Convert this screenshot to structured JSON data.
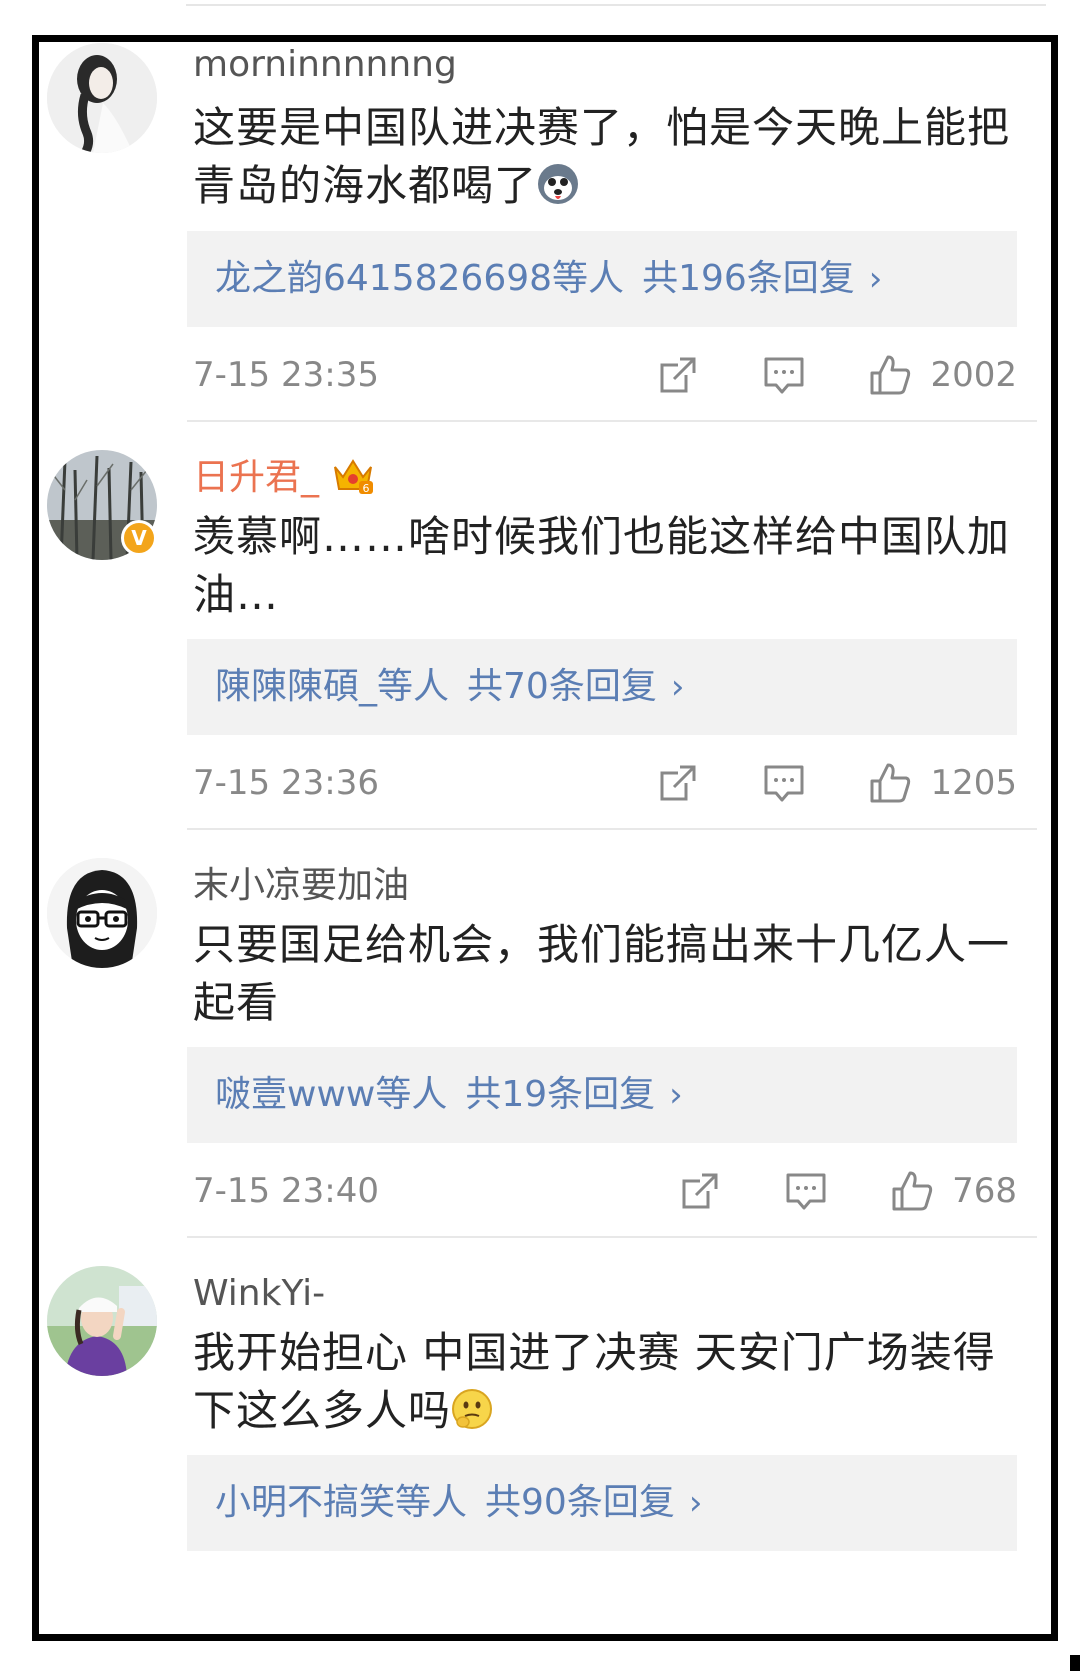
{
  "comments": [
    {
      "username": "morninnnnnng",
      "text": "这要是中国队进决赛了，怕是今天晚上能把青岛的海水都喝了",
      "reply_users": "龙之韵6415826698",
      "reply_suffix": "等人",
      "reply_total": "共196条回复",
      "timestamp": "7-15 23:35",
      "likes": "2002"
    },
    {
      "username": "日升君_",
      "text": "羡慕啊……啥时候我们也能这样给中国队加油…",
      "reply_users": "陳陳陳碩_",
      "reply_suffix": "等人",
      "reply_total": "共70条回复",
      "timestamp": "7-15 23:36",
      "likes": "1205"
    },
    {
      "username": "末小凉要加油",
      "text": "只要国足给机会，我们能搞出来十几亿人一起看",
      "reply_users": "啵壹www",
      "reply_suffix": "等人",
      "reply_total": "共19条回复",
      "timestamp": "7-15 23:40",
      "likes": "768"
    },
    {
      "username": "WinkYi-",
      "text": "我开始担心 中国进了决赛 天安门广场装得下这么多人吗",
      "reply_users": "小明不搞笑",
      "reply_suffix": "等人",
      "reply_total": "共90条回复",
      "timestamp": "",
      "likes": ""
    }
  ],
  "reply_chevron": "›",
  "verified_badge": "V",
  "colors": {
    "link_blue": "#5b7eb4",
    "vip_orange": "#eb7350",
    "meta_gray": "#888888",
    "reply_bg": "#f2f2f2",
    "frame": "#000000"
  },
  "icons": [
    "share-icon",
    "reply-icon",
    "like-icon",
    "crown-badge-icon",
    "verified-icon",
    "husky-emoji",
    "thinking-emoji"
  ]
}
